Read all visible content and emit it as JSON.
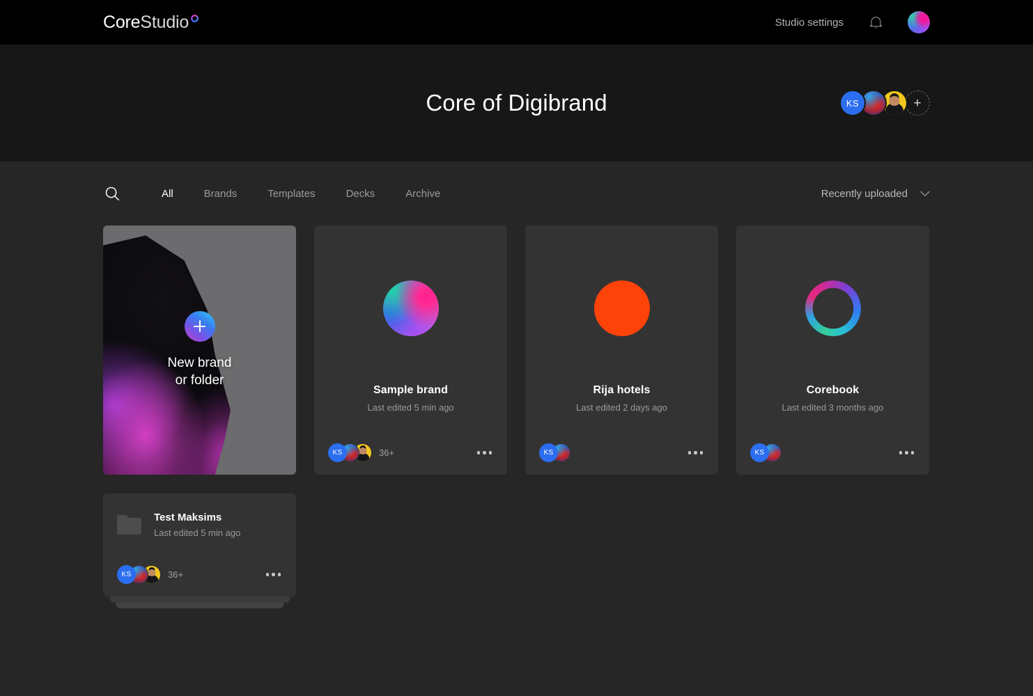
{
  "topbar": {
    "logo_main": "Core",
    "logo_sub": "Studio",
    "logo_ring_icon": "gradient-ring-icon",
    "settings_label": "Studio settings",
    "bell_icon": "bell-icon",
    "avatar_icon": "user-avatar"
  },
  "hero": {
    "title": "Core of Digibrand",
    "members": [
      {
        "type": "initials",
        "label": "KS"
      },
      {
        "type": "photo",
        "label": ""
      },
      {
        "type": "photo",
        "label": ""
      }
    ],
    "add_member_label": "+"
  },
  "toolbar": {
    "search_icon": "search-icon",
    "tabs": [
      {
        "label": "All",
        "active": true
      },
      {
        "label": "Brands",
        "active": false
      },
      {
        "label": "Templates",
        "active": false
      },
      {
        "label": "Decks",
        "active": false
      },
      {
        "label": "Archive",
        "active": false
      }
    ],
    "sort_label": "Recently uploaded",
    "sort_chevron_icon": "chevron-down-icon"
  },
  "new_card": {
    "label": "New brand\nor folder",
    "plus_icon": "plus-icon"
  },
  "cards": [
    {
      "title": "Sample brand",
      "subtitle": "Last edited 5 min ago",
      "thumb": "gradient-blob",
      "avatars": [
        "KS",
        "",
        ""
      ],
      "count": "36+",
      "menu_icon": "more-options-icon"
    },
    {
      "title": "Rija hotels",
      "subtitle": "Last edited 2 days ago",
      "thumb": "orange-circle",
      "avatars": [
        "KS",
        ""
      ],
      "count": "",
      "menu_icon": "more-options-icon"
    },
    {
      "title": "Corebook",
      "subtitle": "Last edited 3 months ago",
      "thumb": "gradient-ring",
      "avatars": [
        "KS",
        ""
      ],
      "count": "",
      "menu_icon": "more-options-icon"
    }
  ],
  "folder": {
    "title": "Test Maksims",
    "subtitle": "Last edited 5 min ago",
    "folder_icon": "folder-icon",
    "avatars": [
      "KS",
      "",
      ""
    ],
    "count": "36+",
    "menu_icon": "more-options-icon"
  },
  "colors": {
    "topbar_bg": "#000000",
    "hero_bg": "#171717",
    "body_bg": "#262626",
    "card_bg": "#333333",
    "accent_blue": "#2b6ef0",
    "rija_orange": "#fd4309",
    "text_primary": "#ffffff",
    "text_muted": "#9a9a9a"
  }
}
